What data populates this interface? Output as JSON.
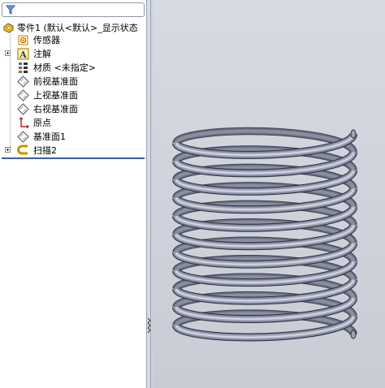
{
  "feature_tree": {
    "root": {
      "label": "零件1  (默认<默认>_显示状态",
      "icon": "part-icon"
    },
    "items": [
      {
        "label": "传感器",
        "icon": "sensor-icon",
        "expandable": false
      },
      {
        "label": "注解",
        "icon": "annotation-icon",
        "expandable": true
      },
      {
        "label": "材质 <未指定>",
        "icon": "material-icon",
        "expandable": false
      },
      {
        "label": "前视基准面",
        "icon": "plane-icon",
        "expandable": false
      },
      {
        "label": "上视基准面",
        "icon": "plane-icon",
        "expandable": false
      },
      {
        "label": "右视基准面",
        "icon": "plane-icon",
        "expandable": false
      },
      {
        "label": "原点",
        "icon": "origin-icon",
        "expandable": false
      },
      {
        "label": "基准面1",
        "icon": "plane-icon",
        "expandable": false
      },
      {
        "label": "扫描2",
        "icon": "sweep-icon",
        "expandable": true
      }
    ]
  },
  "filter": {
    "icon": "filter-icon"
  },
  "viewport": {
    "model": "spring-model",
    "coil_count": 11
  },
  "colors": {
    "accent": "#3a5fa8",
    "spring": "#8e93a6"
  }
}
